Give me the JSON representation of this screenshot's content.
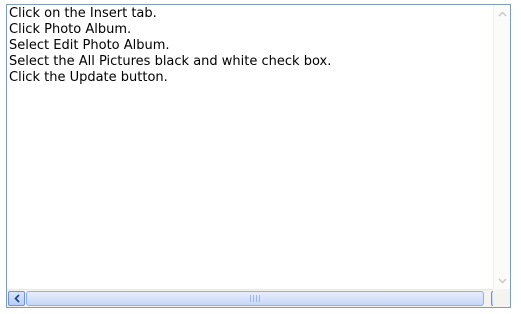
{
  "instructions": {
    "lines": [
      "Click on the Insert tab.",
      "Click Photo Album.",
      "Select Edit Photo Album.",
      "Select the All Pictures black and white check box.",
      "Click the Update button."
    ]
  },
  "scrollbar": {
    "vertical_up_icon": "chevron-up-icon",
    "vertical_down_icon": "chevron-down-icon",
    "horizontal_left_icon": "chevron-left-icon",
    "horizontal_right_icon": "chevron-right-icon",
    "accent_color": "#7591d5"
  }
}
